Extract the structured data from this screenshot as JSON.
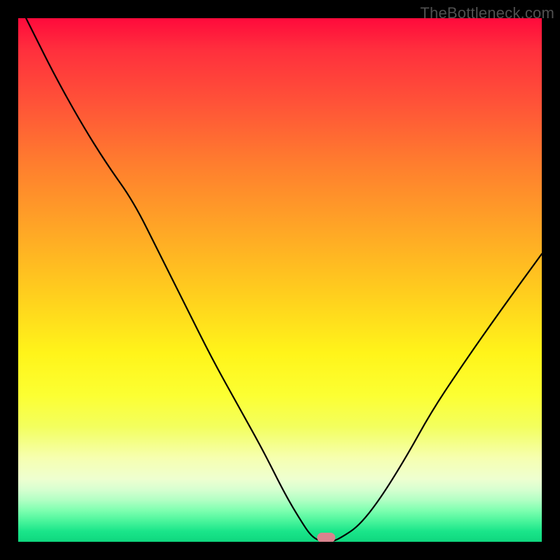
{
  "watermark": "TheBottleneck.com",
  "marker": {
    "x_frac": 0.588,
    "y_frac": 0.992
  },
  "colors": {
    "frame": "#000000",
    "curve": "#000000",
    "marker": "#d9848e",
    "gradient_top": "#ff0a3c",
    "gradient_bottom": "#0fd77e"
  },
  "chart_data": {
    "type": "line",
    "title": "",
    "xlabel": "",
    "ylabel": "",
    "xlim": [
      0,
      100
    ],
    "ylim": [
      0,
      100
    ],
    "grid": false,
    "legend": false,
    "annotations": [
      "TheBottleneck.com"
    ],
    "series": [
      {
        "name": "bottleneck-curve",
        "x": [
          0,
          3,
          7,
          12,
          17,
          22,
          27,
          32,
          37,
          42,
          47,
          51,
          54,
          56,
          58,
          60,
          62,
          65,
          69,
          74,
          79,
          85,
          92,
          100
        ],
        "y": [
          103,
          97,
          89,
          80,
          72,
          65,
          55,
          45,
          35,
          26,
          17,
          9,
          4,
          1,
          0,
          0,
          1,
          3,
          8,
          16,
          25,
          34,
          44,
          55
        ]
      }
    ],
    "marker": {
      "x": 58.8,
      "y": 0.8
    }
  }
}
